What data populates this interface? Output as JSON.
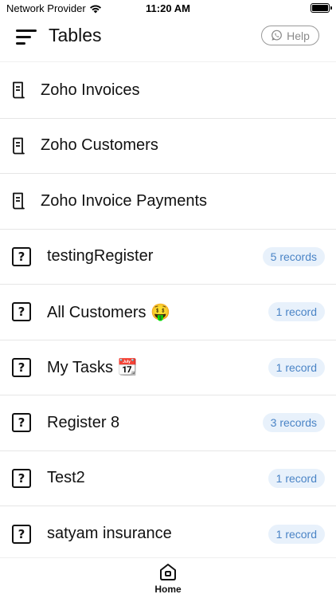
{
  "status_bar": {
    "carrier": "Network Provider",
    "time": "11:20 AM"
  },
  "header": {
    "title": "Tables",
    "help_label": "Help"
  },
  "tables": [
    {
      "label": "Zoho Invoices",
      "icon": "receipt-icon",
      "badge": ""
    },
    {
      "label": "Zoho Customers",
      "icon": "receipt-icon",
      "badge": ""
    },
    {
      "label": "Zoho Invoice Payments",
      "icon": "receipt-icon",
      "badge": ""
    },
    {
      "label": "testingRegister",
      "icon": "question-box-icon",
      "badge": "5 records"
    },
    {
      "label": "All Customers 🤑",
      "icon": "question-box-icon",
      "badge": "1 record"
    },
    {
      "label": "My Tasks 📆",
      "icon": "question-box-icon",
      "badge": "1 record"
    },
    {
      "label": "Register 8",
      "icon": "question-box-icon",
      "badge": "3 records"
    },
    {
      "label": "Test2",
      "icon": "question-box-icon",
      "badge": "1 record"
    },
    {
      "label": "satyam insurance",
      "icon": "question-box-icon",
      "badge": "1 record"
    }
  ],
  "tab_bar": {
    "home_label": "Home"
  },
  "colors": {
    "badge_bg": "#e8f1fb",
    "badge_text": "#4a84c6",
    "help_border": "#9a9a9a"
  }
}
